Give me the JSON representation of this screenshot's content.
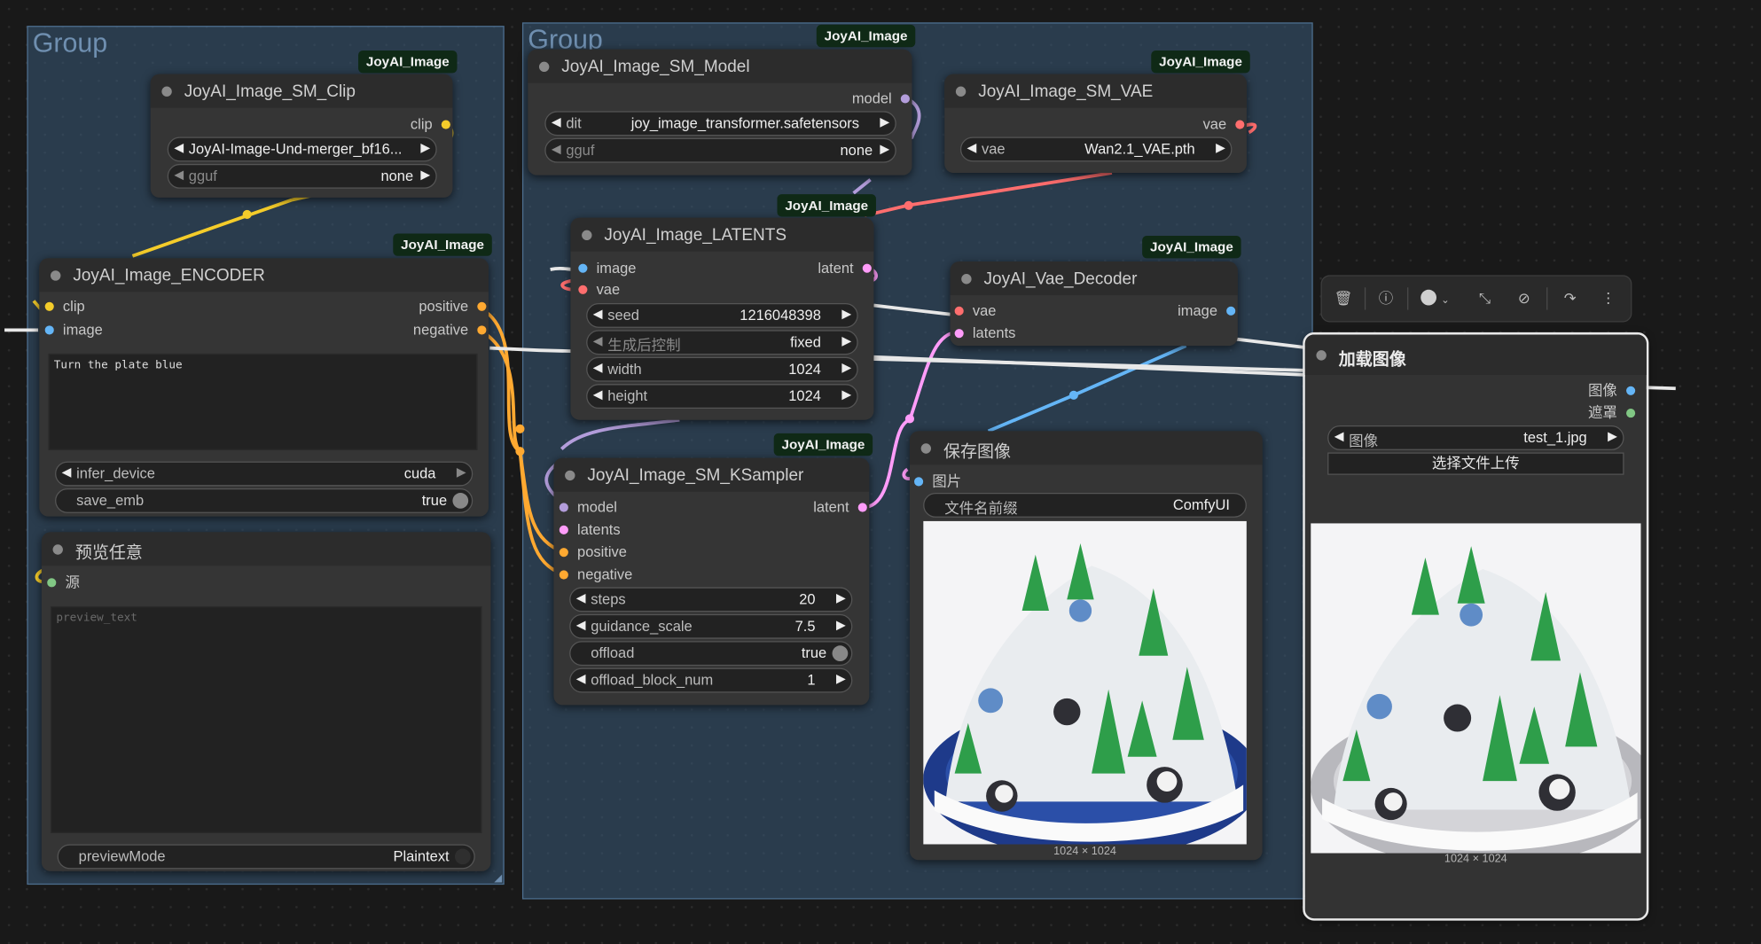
{
  "groups": [
    {
      "title": "Group"
    },
    {
      "title": "Group"
    }
  ],
  "badge": "JoyAI_Image",
  "clip": {
    "title": "JoyAI_Image_SM_Clip",
    "out": "clip",
    "model_value": "JoyAI-Image-Und-merger_bf16...",
    "gguf_label": "gguf",
    "gguf_value": "none"
  },
  "model": {
    "title": "JoyAI_Image_SM_Model",
    "out": "model",
    "dit_label": "dit",
    "dit_value": "joy_image_transformer.safetensors",
    "gguf_label": "gguf",
    "gguf_value": "none"
  },
  "vae": {
    "title": "JoyAI_Image_SM_VAE",
    "out": "vae",
    "vae_label": "vae",
    "vae_value": "Wan2.1_VAE.pth"
  },
  "latents": {
    "title": "JoyAI_Image_LATENTS",
    "in_image": "image",
    "in_vae": "vae",
    "out": "latent",
    "seed_label": "seed",
    "seed_value": "1216048398",
    "control_label": "生成后控制",
    "control_value": "fixed",
    "width_label": "width",
    "width_value": "1024",
    "height_label": "height",
    "height_value": "1024"
  },
  "encoder": {
    "title": "JoyAI_Image_ENCODER",
    "in_clip": "clip",
    "in_image": "image",
    "out_positive": "positive",
    "out_negative": "negative",
    "prompt": "Turn the plate blue",
    "device_label": "infer_device",
    "device_value": "cuda",
    "emb_label": "save_emb",
    "emb_value": "true"
  },
  "decoder": {
    "title": "JoyAI_Vae_Decoder",
    "in_vae": "vae",
    "in_latents": "latents",
    "out": "image"
  },
  "sampler": {
    "title": "JoyAI_Image_SM_KSampler",
    "in_model": "model",
    "in_latents": "latents",
    "in_positive": "positive",
    "in_negative": "negative",
    "out": "latent",
    "steps_label": "steps",
    "steps_value": "20",
    "guidance_label": "guidance_scale",
    "guidance_value": "7.5",
    "offload_label": "offload",
    "offload_value": "true",
    "block_label": "offload_block_num",
    "block_value": "1"
  },
  "preview": {
    "title": "预览任意",
    "in_source": "源",
    "placeholder": "preview_text",
    "mode_label": "previewMode",
    "mode_value": "Plaintext"
  },
  "save": {
    "title": "保存图像",
    "in_images": "图片",
    "prefix_label": "文件名前缀",
    "prefix_value": "ComfyUI",
    "size": "1024 × 1024"
  },
  "load": {
    "title": "加载图像",
    "out_image": "图像",
    "out_mask": "遮罩",
    "image_label": "图像",
    "image_value": "test_1.jpg",
    "upload": "选择文件上传",
    "size": "1024 × 1024"
  },
  "colors": {
    "clip": "#f4cc2a",
    "model": "#b39ddb",
    "vae": "#ff6e6e",
    "latent": "#ff9cf9",
    "image": "#64b5f6",
    "conditioning": "#ffa931",
    "mask": "#81c784",
    "string": "#e8e8e8"
  }
}
